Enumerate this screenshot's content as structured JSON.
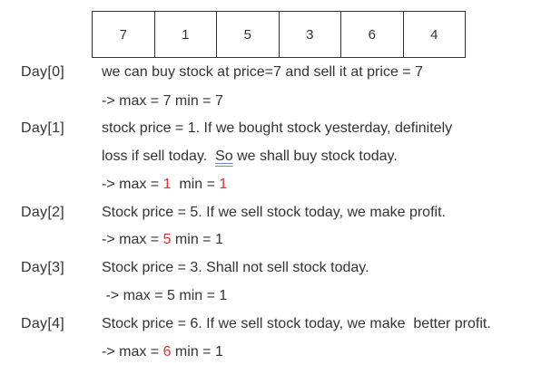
{
  "prices": [
    "7",
    "1",
    "5",
    "3",
    "6",
    "4"
  ],
  "day0": {
    "label": "Day[0]",
    "text": "we can buy stock at price=7 and sell it at price = 7",
    "max_prefix": "-> max = 7",
    "min_part": " min = 7"
  },
  "day1": {
    "label": "Day[1]",
    "text1": "stock price = 1. If we bought stock yesterday, definitely",
    "text2_a": "loss if sell today.  ",
    "text2_so": "So",
    "text2_b": " we shall buy stock today.",
    "max_prefix": "-> max = ",
    "max_val": "1",
    "min_prefix": "  min = ",
    "min_val": "1"
  },
  "day2": {
    "label": "Day[2]",
    "text": "Stock price = 5. If we sell stock today, we make profit.",
    "max_prefix": "-> max = ",
    "max_val": "5",
    "min_part": " min = 1"
  },
  "day3": {
    "label": "Day[3]",
    "text": "Stock price = 3. Shall not sell stock today.",
    "max_line": " -> max = 5 min = 1"
  },
  "day4": {
    "label": "Day[4]",
    "text": "Stock price = 6. If we sell stock today, we make  better profit.",
    "max_prefix": "-> max = ",
    "max_val": "6",
    "min_part": " min = 1"
  },
  "colors": {
    "text": "#333333",
    "highlight": "#e8302a"
  }
}
